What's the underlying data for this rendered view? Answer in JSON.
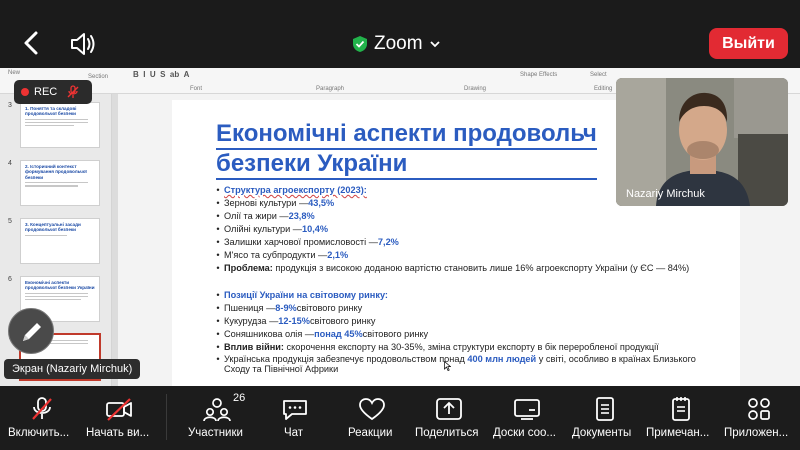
{
  "header": {
    "meeting_title": "Zoom",
    "leave_label": "Выйти"
  },
  "recording": {
    "label": "REC"
  },
  "slides_panel": {
    "numbers": [
      "3",
      "4",
      "5",
      "6",
      "7"
    ],
    "thumbs": [
      "1. Поняття та складові продовольчої безпеки",
      "2. Історичний контекст формування продовольчої безпеки",
      "3. Концептуальні засади продовольчої безпеки",
      "Економічні аспекти продовольчої безпеки України",
      ""
    ]
  },
  "ribbon": {
    "font": "Font",
    "paragraph": "Paragraph",
    "drawing": "Drawing",
    "editing": "Editing",
    "new_slide": "New",
    "section": "Section",
    "select": "Select",
    "shape_effects": "Shape Effects"
  },
  "slide": {
    "title_line1": "Економічні аспекти продовольч",
    "title_line2": "безпеки України",
    "export_heading": "Структура агроекспорту (2023):",
    "export_items": [
      {
        "label": "Зернові культури — ",
        "value": "43,5%"
      },
      {
        "label": "Олії та жири — ",
        "value": "23,8%"
      },
      {
        "label": "Олійні культури — ",
        "value": "10,4%"
      },
      {
        "label": "Залишки харчової промисловості — ",
        "value": "7,2%"
      },
      {
        "label": "М'ясо та субпродукти — ",
        "value": "2,1%"
      }
    ],
    "problem_label": "Проблема:",
    "problem_text": " продукція з високою доданою вартістю становить лише 16% агроекспорту України (у ЄС — 84%)",
    "position_heading": "Позиції України на світовому ринку:",
    "position_items": [
      {
        "label": "Пшениця — ",
        "value": "8-9%",
        "suffix": " світового ринку"
      },
      {
        "label": "Кукурудза — ",
        "value": "12-15%",
        "suffix": " світового ринку"
      },
      {
        "label": "Соняшникова олія — ",
        "value": "понад 45%",
        "suffix": " світового ринку"
      }
    ],
    "war_label": "Вплив війни:",
    "war_text": " скорочення експорту на 30-35%, зміна структури експорту в бік переробленої продукції",
    "food_text_a": "Українська продукція забезпечує продовольством понад ",
    "food_value": "400 млн людей",
    "food_text_b": " у світі, особливо в країнах Близького",
    "food_text_c": "Сходу та Північної Африки"
  },
  "video": {
    "participant_name": "Nazariy Mirchuk"
  },
  "screen_share_label": "Экран (Nazariy Mirchuk)",
  "toolbar": {
    "items": [
      {
        "label": "Включить..."
      },
      {
        "label": "Начать ви..."
      },
      {
        "label": "Участники",
        "badge": "26"
      },
      {
        "label": "Чат"
      },
      {
        "label": "Реакции"
      },
      {
        "label": "Поделиться"
      },
      {
        "label": "Доски соо..."
      },
      {
        "label": "Документы"
      },
      {
        "label": "Примечан..."
      },
      {
        "label": "Приложен..."
      }
    ]
  },
  "colors": {
    "leave_button": "#e22a33",
    "slide_accent": "#2b5cc0",
    "rec_dot": "#e33333"
  }
}
